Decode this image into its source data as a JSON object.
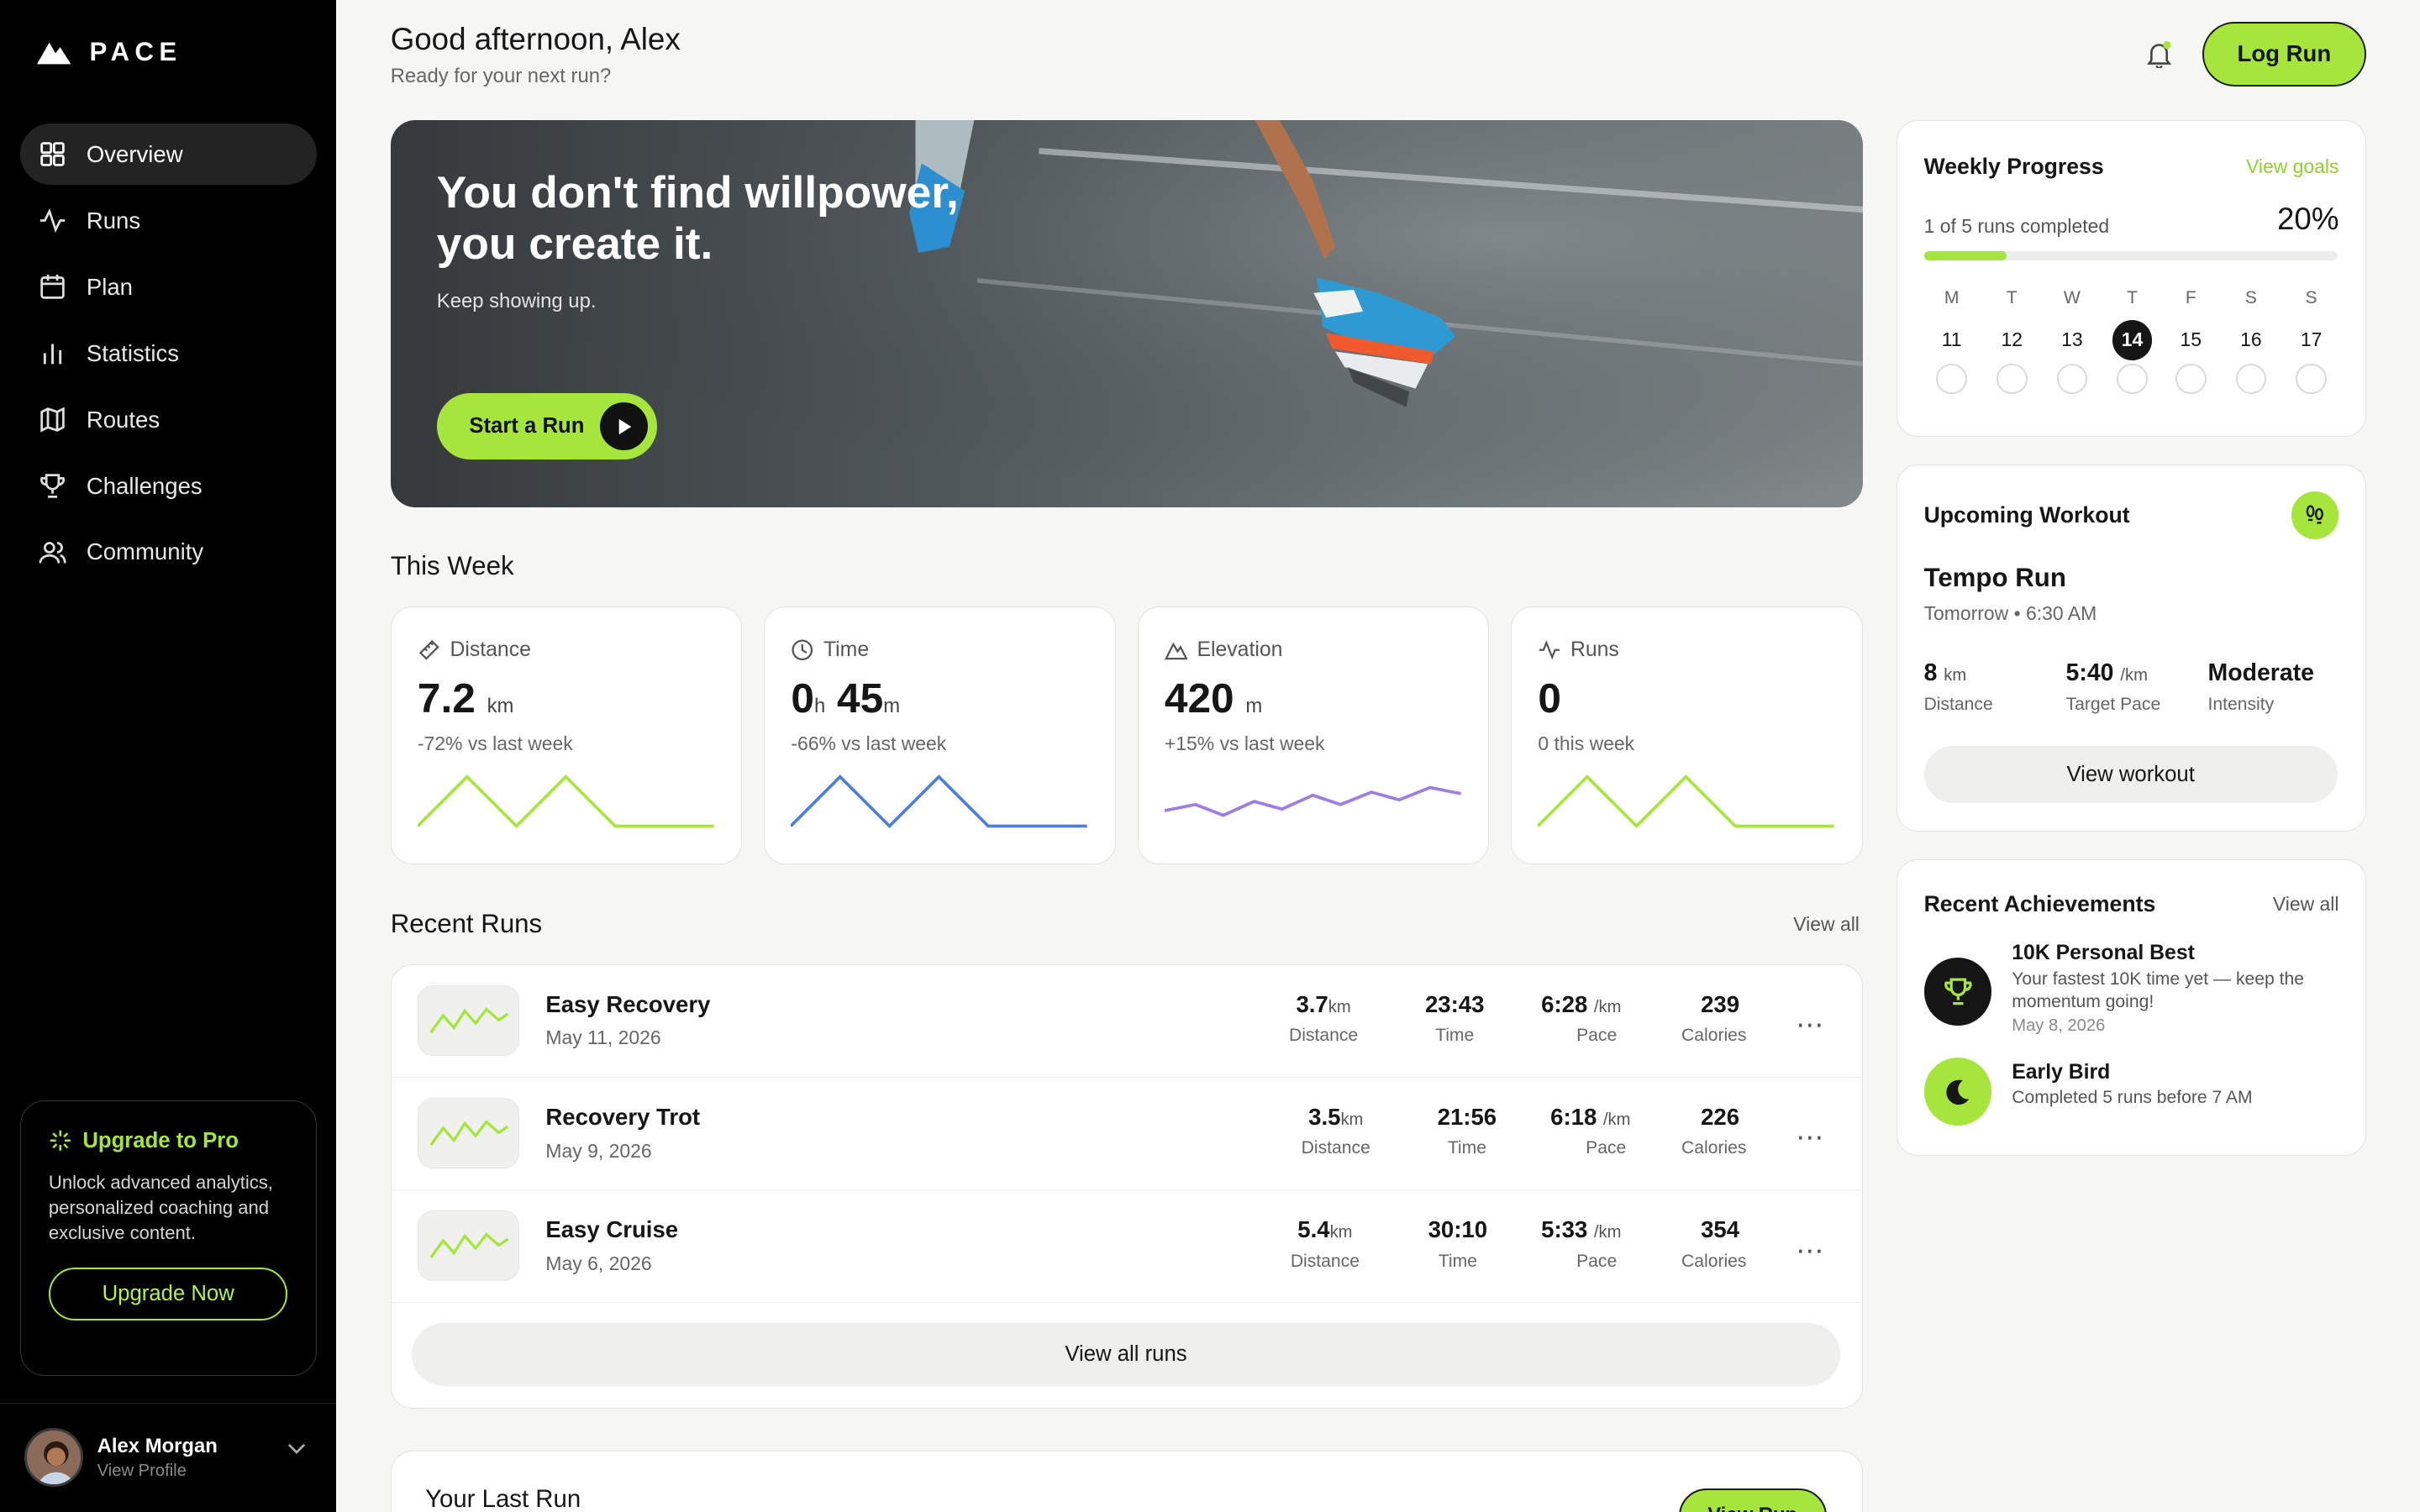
{
  "brand": {
    "name": "PACE"
  },
  "sidebar": {
    "items": [
      {
        "label": "Overview",
        "icon": "grid-icon"
      },
      {
        "label": "Runs",
        "icon": "activity-icon"
      },
      {
        "label": "Plan",
        "icon": "calendar-icon"
      },
      {
        "label": "Statistics",
        "icon": "bar-chart-icon"
      },
      {
        "label": "Routes",
        "icon": "map-icon"
      },
      {
        "label": "Challenges",
        "icon": "trophy-icon"
      },
      {
        "label": "Community",
        "icon": "users-icon"
      }
    ],
    "active_index": 0,
    "upgrade": {
      "title": "Upgrade to Pro",
      "text": "Unlock advanced analytics, personalized coaching and exclusive content.",
      "button": "Upgrade Now"
    },
    "profile": {
      "name": "Alex Morgan",
      "sub": "View Profile"
    }
  },
  "header": {
    "greeting": "Good afternoon, Alex",
    "subtitle": "Ready for your next run?",
    "log_button": "Log Run"
  },
  "hero": {
    "line1": "You don't find willpower,",
    "line2": "you create it.",
    "sub": "Keep showing up.",
    "button": "Start a Run"
  },
  "this_week": {
    "title": "This Week",
    "stats": [
      {
        "label": "Distance",
        "icon": "ruler-icon",
        "value": "7.2",
        "unit": "km",
        "delta": "-72% vs last week",
        "color": "#a6e63c"
      },
      {
        "label": "Time",
        "icon": "clock-icon",
        "value_h": "0",
        "unit_h": "h",
        "value_m": "45",
        "unit_m": "m",
        "delta": "-66% vs last week",
        "color": "#4a7fe0"
      },
      {
        "label": "Elevation",
        "icon": "mountain-icon",
        "value": "420",
        "unit": "m",
        "delta": "+15% vs last week",
        "color": "#9b7ce8"
      },
      {
        "label": "Runs",
        "icon": "pulse-icon",
        "value": "0",
        "unit": "",
        "delta": "0 this week",
        "color": "#a6e63c"
      }
    ]
  },
  "recent_runs": {
    "title": "Recent Runs",
    "view_all": "View all",
    "view_all_button": "View all runs",
    "rows": [
      {
        "name": "Easy Recovery",
        "date": "May 11, 2026",
        "distance": "3.7",
        "dist_unit": "km",
        "time": "23:43",
        "pace": "6:28",
        "pace_unit": "/km",
        "calories": "239"
      },
      {
        "name": "Recovery Trot",
        "date": "May 9, 2026",
        "distance": "3.5",
        "dist_unit": "km",
        "time": "21:56",
        "pace": "6:18",
        "pace_unit": "/km",
        "calories": "226"
      },
      {
        "name": "Easy Cruise",
        "date": "May 6, 2026",
        "distance": "5.4",
        "dist_unit": "km",
        "time": "30:10",
        "pace": "5:33",
        "pace_unit": "/km",
        "calories": "354"
      }
    ],
    "labels": {
      "distance": "Distance",
      "time": "Time",
      "pace": "Pace",
      "calories": "Calories"
    }
  },
  "last_run": {
    "title": "Your Last Run",
    "button": "View Run"
  },
  "weekly_progress": {
    "title": "Weekly Progress",
    "link": "View goals",
    "count": "1 of 5 runs completed",
    "percent": "20%",
    "fraction": 0.2,
    "days": [
      {
        "l": "M",
        "n": "11"
      },
      {
        "l": "T",
        "n": "12"
      },
      {
        "l": "W",
        "n": "13"
      },
      {
        "l": "T",
        "n": "14",
        "today": true
      },
      {
        "l": "F",
        "n": "15"
      },
      {
        "l": "S",
        "n": "16"
      },
      {
        "l": "S",
        "n": "17"
      }
    ]
  },
  "upcoming": {
    "title": "Upcoming Workout",
    "name": "Tempo Run",
    "when": "Tomorrow • 6:30 AM",
    "metrics": [
      {
        "v": "8",
        "u": "km",
        "l": "Distance"
      },
      {
        "v": "5:40",
        "u": "/km",
        "l": "Target Pace"
      },
      {
        "v": "Moderate",
        "u": "",
        "l": "Intensity"
      }
    ],
    "button": "View workout"
  },
  "achievements": {
    "title": "Recent Achievements",
    "link": "View all",
    "items": [
      {
        "title": "10K Personal Best",
        "desc": "Your fastest 10K time yet — keep the momentum going!",
        "date": "May 8, 2026",
        "icon": "trophy-icon"
      },
      {
        "title": "Early Bird",
        "desc": "Completed 5 runs before 7 AM",
        "date": "",
        "icon": "moon-icon"
      }
    ]
  },
  "colors": {
    "accent": "#a6e63c",
    "dark": "#161616"
  }
}
